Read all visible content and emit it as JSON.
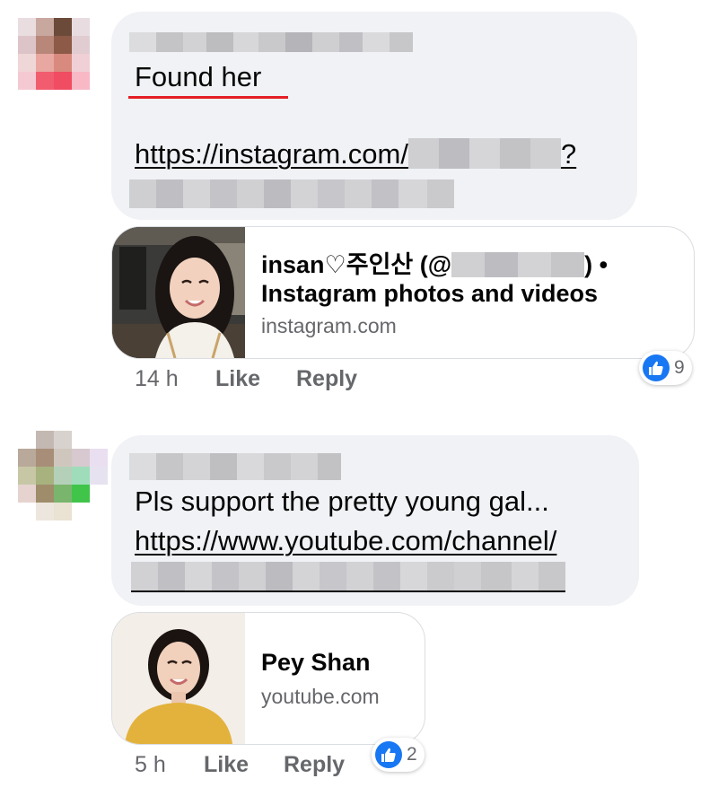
{
  "colors": {
    "bubble": "#f0f2f5",
    "meta_text": "#65676b",
    "like_blue": "#1877f2",
    "highlight_underline": "#e41e26"
  },
  "comments": [
    {
      "text_line": "Found her",
      "link_visible": "https://instagram.com/",
      "link_suffix": "?",
      "link_card": {
        "title_prefix": "insan♡주인산 (@",
        "title_suffix": ") •",
        "title_line2": "Instagram photos and videos",
        "domain": "instagram.com"
      },
      "timestamp": "14 h",
      "like_label": "Like",
      "reply_label": "Reply",
      "reaction_icon": "thumbs-up-icon",
      "reaction_count": "9"
    },
    {
      "text_line": "Pls support the pretty young gal...",
      "link_visible": "https://www.youtube.com/channel/",
      "link_card": {
        "title": "Pey Shan",
        "domain": "youtube.com"
      },
      "timestamp": "5 h",
      "like_label": "Like",
      "reply_label": "Reply",
      "reaction_icon": "thumbs-up-icon",
      "reaction_count": "2"
    }
  ]
}
